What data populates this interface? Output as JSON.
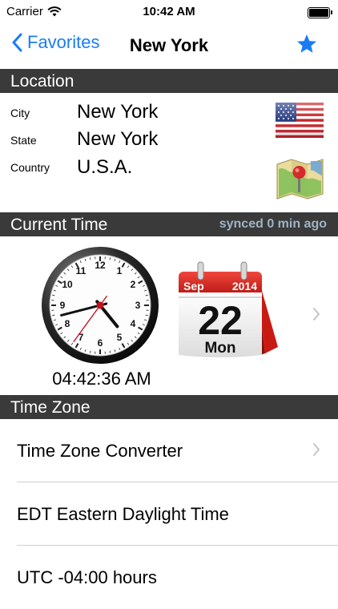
{
  "status": {
    "carrier": "Carrier",
    "time": "10:42 AM"
  },
  "nav": {
    "back_label": "Favorites",
    "title": "New York"
  },
  "location": {
    "header": "Location",
    "city_label": "City",
    "city": "New York",
    "state_label": "State",
    "state": "New York",
    "country_label": "Country",
    "country": "U.S.A."
  },
  "current_time": {
    "header": "Current Time",
    "synced": "synced 0 min ago",
    "digital": "04:42:36 AM",
    "clock": {
      "hour": 4,
      "minute": 42,
      "second": 36
    },
    "calendar": {
      "month": "Sep",
      "year": "2014",
      "day": "22",
      "weekday": "Mon"
    }
  },
  "time_zone": {
    "header": "Time Zone",
    "rows": [
      "Time Zone Converter",
      "EDT Eastern Daylight Time",
      "UTC -04:00 hours"
    ]
  },
  "colors": {
    "accent": "#1a7cf5",
    "header_bg": "#3a3a3a",
    "sync_text": "#9fb3c5",
    "calendar_red": "#d9251d"
  }
}
